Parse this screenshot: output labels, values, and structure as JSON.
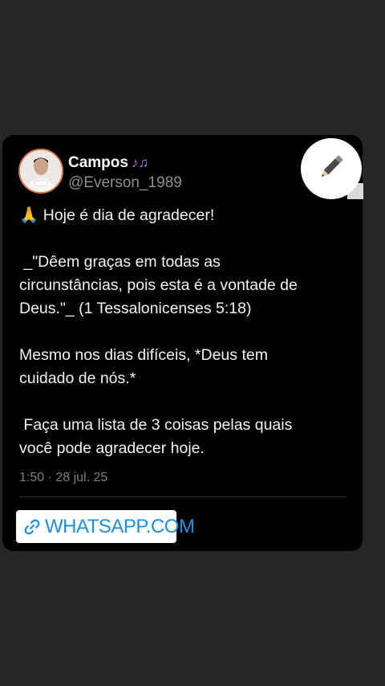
{
  "profile": {
    "name": "Campos",
    "name_icon": "musical-notes-icon",
    "handle": "@Everson_1989"
  },
  "edit_button": {
    "icon": "pencil-icon"
  },
  "post": {
    "line1": "🙏 Hoje é dia de agradecer!",
    "quote_line1": " _\"Dêem graças em todas as",
    "quote_line2": "circunstâncias, pois esta é a vontade de",
    "quote_line3": "Deus.\"_ (1 Tessalonicenses 5:18)",
    "line3a": "Mesmo nos dias difíceis, *Deus tem",
    "line3b": "cuidado de nós.*",
    "line4a": " Faça uma lista de 3 coisas pelas quais",
    "line4b": "você pode agradecer hoje."
  },
  "timestamp": "1:50 · 28 jul. 25",
  "link": {
    "icon": "link-icon",
    "label": "WHATSAPP.COM",
    "color": "#1d8fe0"
  }
}
